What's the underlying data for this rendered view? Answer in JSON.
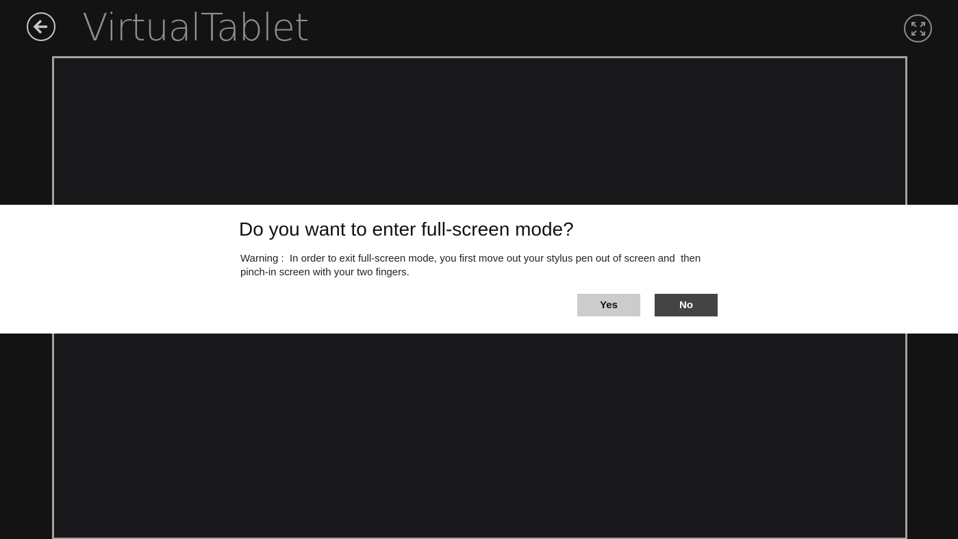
{
  "app": {
    "title": "VirtualTablet"
  },
  "header": {
    "back_icon": "arrow-left-circle-icon",
    "fullscreen_icon": "expand-arrows-icon"
  },
  "dialog": {
    "title": "Do you want to enter full-screen mode?",
    "message": "Warning :  In order to exit full-screen mode, you first move out your stylus pen out of screen and  then pinch-in screen with your two fingers.",
    "yes_label": "Yes",
    "no_label": "No"
  },
  "colors": {
    "background": "#131313",
    "canvas": "#18171a",
    "canvas_border": "#a3a3a3",
    "title_text": "#8e8e8e",
    "dialog_background": "#ffffff",
    "yes_button": "#cccccc",
    "no_button": "#444444"
  }
}
